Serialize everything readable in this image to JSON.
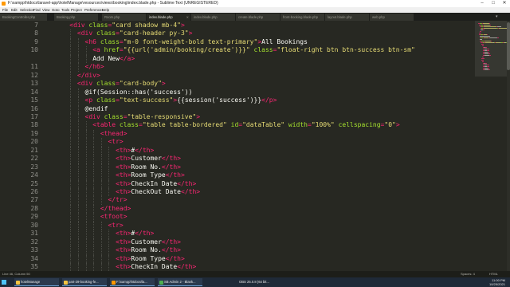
{
  "window": {
    "title": "F:\\xampp\\htdocs\\laravel-app\\hotelManage\\resources\\views\\booking\\index.blade.php - Sublime Text (UNREGISTERED)"
  },
  "menu": [
    "File",
    "Edit",
    "Selection",
    "Find",
    "View",
    "Goto",
    "Tools",
    "Project",
    "Preferences",
    "Help"
  ],
  "tabs": [
    {
      "label": "BookingController.php",
      "active": false
    },
    {
      "label": "Booking.php",
      "active": false
    },
    {
      "label": "Room.php",
      "active": false
    },
    {
      "label": "index.blade.php",
      "active": true
    },
    {
      "label": "index.blade.php",
      "active": false
    },
    {
      "label": "create.blade.php",
      "active": false
    },
    {
      "label": "front-booking.blade.php",
      "active": false
    },
    {
      "label": "layout.blade.php",
      "active": false
    },
    {
      "label": "web.php",
      "active": false
    }
  ],
  "editor": {
    "first_line": 7,
    "lines": [
      {
        "n": "7",
        "indent": 4,
        "parts": [
          [
            "tag",
            "<div "
          ],
          [
            "attr",
            "class"
          ],
          [
            "tag",
            "="
          ],
          [
            "str",
            "\"card shadow mb-4\""
          ],
          [
            "tag",
            ">"
          ]
        ]
      },
      {
        "n": "8",
        "indent": 6,
        "parts": [
          [
            "tag",
            "<div "
          ],
          [
            "attr",
            "class"
          ],
          [
            "tag",
            "="
          ],
          [
            "str",
            "\"card-header py-3\""
          ],
          [
            "tag",
            ">"
          ]
        ]
      },
      {
        "n": "9",
        "indent": 8,
        "parts": [
          [
            "tag",
            "<h6 "
          ],
          [
            "attr",
            "class"
          ],
          [
            "tag",
            "="
          ],
          [
            "str",
            "\"m-0 font-weight-bold text-primary\""
          ],
          [
            "tag",
            ">"
          ],
          [
            "txt",
            "All Bookings"
          ]
        ]
      },
      {
        "n": "10",
        "indent": 10,
        "parts": [
          [
            "tag",
            "<a "
          ],
          [
            "attr",
            "href"
          ],
          [
            "tag",
            "="
          ],
          [
            "str",
            "\"{{url('admin/booking/create')}}\""
          ],
          [
            "txt",
            " "
          ],
          [
            "attr",
            "class"
          ],
          [
            "tag",
            "="
          ],
          [
            "str",
            "\"float-right btn btn-success btn-sm\""
          ]
        ]
      },
      {
        "n": "",
        "indent": 10,
        "parts": [
          [
            "txt",
            "Add New"
          ],
          [
            "tag",
            "</a>"
          ]
        ]
      },
      {
        "n": "11",
        "indent": 8,
        "parts": [
          [
            "tag",
            "</h6>"
          ]
        ]
      },
      {
        "n": "12",
        "indent": 6,
        "parts": [
          [
            "tag",
            "</div>"
          ]
        ]
      },
      {
        "n": "13",
        "indent": 6,
        "parts": [
          [
            "tag",
            "<div "
          ],
          [
            "attr",
            "class"
          ],
          [
            "tag",
            "="
          ],
          [
            "str",
            "\"card-body\""
          ],
          [
            "tag",
            ">"
          ]
        ]
      },
      {
        "n": "14",
        "indent": 8,
        "parts": [
          [
            "txt",
            "@if(Session::has('success'))"
          ]
        ]
      },
      {
        "n": "15",
        "indent": 8,
        "parts": [
          [
            "tag",
            "<p "
          ],
          [
            "attr",
            "class"
          ],
          [
            "tag",
            "="
          ],
          [
            "str",
            "\"text-success\""
          ],
          [
            "tag",
            ">"
          ],
          [
            "txt",
            "{{session('success')}}"
          ],
          [
            "tag",
            "</p>"
          ]
        ]
      },
      {
        "n": "16",
        "indent": 8,
        "parts": [
          [
            "txt",
            "@endif"
          ]
        ]
      },
      {
        "n": "17",
        "indent": 8,
        "parts": [
          [
            "tag",
            "<div "
          ],
          [
            "attr",
            "class"
          ],
          [
            "tag",
            "="
          ],
          [
            "str",
            "\"table-responsive\""
          ],
          [
            "tag",
            ">"
          ]
        ]
      },
      {
        "n": "18",
        "indent": 10,
        "parts": [
          [
            "tag",
            "<table "
          ],
          [
            "attr",
            "class"
          ],
          [
            "tag",
            "="
          ],
          [
            "str",
            "\"table table-bordered\""
          ],
          [
            "txt",
            " "
          ],
          [
            "attr",
            "id"
          ],
          [
            "tag",
            "="
          ],
          [
            "str",
            "\"dataTable\""
          ],
          [
            "txt",
            " "
          ],
          [
            "attr",
            "width"
          ],
          [
            "tag",
            "="
          ],
          [
            "str",
            "\"100%\""
          ],
          [
            "txt",
            " "
          ],
          [
            "attr",
            "cellspacing"
          ],
          [
            "tag",
            "="
          ],
          [
            "str",
            "\"0\""
          ],
          [
            "tag",
            ">"
          ]
        ]
      },
      {
        "n": "19",
        "indent": 12,
        "parts": [
          [
            "tag",
            "<thead>"
          ]
        ]
      },
      {
        "n": "20",
        "indent": 14,
        "parts": [
          [
            "tag",
            "<tr>"
          ]
        ]
      },
      {
        "n": "21",
        "indent": 16,
        "parts": [
          [
            "tag",
            "<th>"
          ],
          [
            "txt",
            "#"
          ],
          [
            "tag",
            "</th>"
          ]
        ]
      },
      {
        "n": "22",
        "indent": 16,
        "parts": [
          [
            "tag",
            "<th>"
          ],
          [
            "txt",
            "Customer"
          ],
          [
            "tag",
            "</th>"
          ]
        ]
      },
      {
        "n": "23",
        "indent": 16,
        "parts": [
          [
            "tag",
            "<th>"
          ],
          [
            "txt",
            "Room No."
          ],
          [
            "tag",
            "</th>"
          ]
        ]
      },
      {
        "n": "24",
        "indent": 16,
        "parts": [
          [
            "tag",
            "<th>"
          ],
          [
            "txt",
            "Room Type"
          ],
          [
            "tag",
            "</th>"
          ]
        ]
      },
      {
        "n": "25",
        "indent": 16,
        "parts": [
          [
            "tag",
            "<th>"
          ],
          [
            "txt",
            "CheckIn Date"
          ],
          [
            "tag",
            "</th>"
          ]
        ]
      },
      {
        "n": "26",
        "indent": 16,
        "parts": [
          [
            "tag",
            "<th>"
          ],
          [
            "txt",
            "CheckOut Date"
          ],
          [
            "tag",
            "</th>"
          ]
        ]
      },
      {
        "n": "27",
        "indent": 14,
        "parts": [
          [
            "tag",
            "</tr>"
          ]
        ]
      },
      {
        "n": "28",
        "indent": 12,
        "parts": [
          [
            "tag",
            "</thead>"
          ]
        ]
      },
      {
        "n": "29",
        "indent": 12,
        "parts": [
          [
            "tag",
            "<tfoot>"
          ]
        ]
      },
      {
        "n": "30",
        "indent": 14,
        "parts": [
          [
            "tag",
            "<tr>"
          ]
        ]
      },
      {
        "n": "31",
        "indent": 16,
        "parts": [
          [
            "tag",
            "<th>"
          ],
          [
            "txt",
            "#"
          ],
          [
            "tag",
            "</th>"
          ]
        ]
      },
      {
        "n": "32",
        "indent": 16,
        "parts": [
          [
            "tag",
            "<th>"
          ],
          [
            "txt",
            "Customer"
          ],
          [
            "tag",
            "</th>"
          ]
        ]
      },
      {
        "n": "33",
        "indent": 16,
        "parts": [
          [
            "tag",
            "<th>"
          ],
          [
            "txt",
            "Room No."
          ],
          [
            "tag",
            "</th>"
          ]
        ]
      },
      {
        "n": "34",
        "indent": 16,
        "parts": [
          [
            "tag",
            "<th>"
          ],
          [
            "txt",
            "Room Type"
          ],
          [
            "tag",
            "</th>"
          ]
        ]
      },
      {
        "n": "35",
        "indent": 16,
        "parts": [
          [
            "tag",
            "<th>"
          ],
          [
            "txt",
            "CheckIn Date"
          ],
          [
            "tag",
            "</th>"
          ]
        ]
      }
    ]
  },
  "status": {
    "position": "Line 46, Column 50",
    "right": [
      "Spaces: 4",
      "HTML"
    ]
  },
  "taskbar": {
    "tasks": [
      {
        "label": "hotelManage",
        "color": "#f4c542"
      },
      {
        "label": "part-29-booking-fe...",
        "color": "#f4c542"
      },
      {
        "label": "F:\\xampp\\htdocs\\la...",
        "color": "#ff9800"
      },
      {
        "label": "SB Admin 2 - Blank...",
        "color": "#4caf50"
      }
    ],
    "tray_text": "OBS 25.0.8 (64 bit...",
    "time": "11:00 PM",
    "date": "10/25/2021"
  },
  "colors": {
    "tag": "#f92672",
    "attr": "#a6e22e",
    "string": "#e6db74",
    "text": "#f8f8f2",
    "background": "#272822"
  }
}
